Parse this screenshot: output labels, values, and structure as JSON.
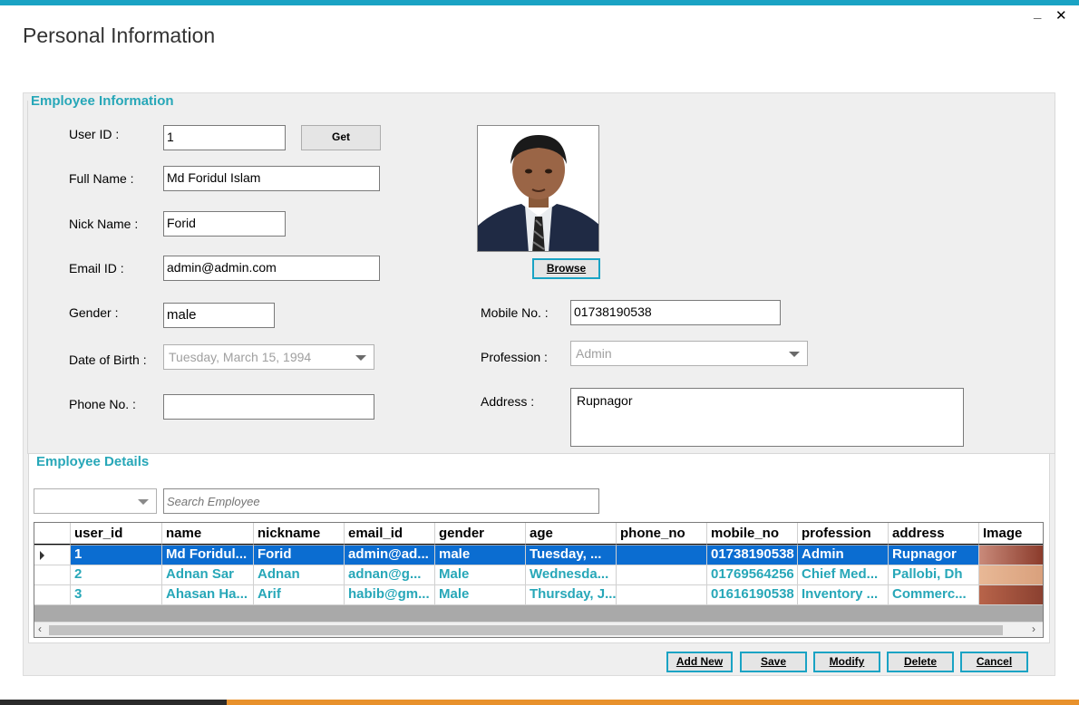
{
  "window": {
    "title": "Personal Information",
    "minimize": "_",
    "close": "✕"
  },
  "employee_info": {
    "group_title": "Employee Information",
    "labels": {
      "user_id": "User ID :",
      "full_name": "Full Name :",
      "nick_name": "Nick Name :",
      "email_id": "Email ID :",
      "gender": "Gender :",
      "dob": "Date of Birth :",
      "phone": "Phone No. :",
      "mobile": "Mobile No. :",
      "profession": "Profession :",
      "address": "Address :"
    },
    "values": {
      "user_id": "1",
      "full_name": "Md Foridul Islam",
      "nick_name": "Forid",
      "email_id": "admin@admin.com",
      "gender": "male",
      "dob": "Tuesday, March 15, 1994",
      "phone": "",
      "mobile": "01738190538",
      "profession": "Admin",
      "address": "Rupnagor"
    },
    "get_button": "Get",
    "browse_button": "Browse"
  },
  "employee_details": {
    "group_title": "Employee Details",
    "filter_value": "",
    "search_placeholder": "Search Employee",
    "columns": [
      "user_id",
      "name",
      "nickname",
      "email_id",
      "gender",
      "age",
      "phone_no",
      "mobile_no",
      "profession",
      "address",
      "Image"
    ],
    "rows": [
      [
        "1",
        "Md Foridul...",
        "Forid",
        "admin@ad...",
        "male",
        "Tuesday, ...",
        "",
        "01738190538",
        "Admin",
        "Rupnagor",
        ""
      ],
      [
        "2",
        "Adnan Sar",
        "Adnan",
        "adnan@g...",
        "Male",
        "Wednesda...",
        "",
        "01769564256",
        "Chief Med...",
        "Pallobi, Dh",
        ""
      ],
      [
        "3",
        "Ahasan Ha...",
        "Arif",
        "habib@gm...",
        "Male",
        "Thursday, J...",
        "",
        "01616190538",
        "Inventory ...",
        "Commerc...",
        ""
      ]
    ],
    "selected_row": 0,
    "scroll_left": "‹",
    "scroll_right": "›"
  },
  "actions": {
    "add_new": "Add New",
    "save": "Save",
    "modify": "Modify",
    "delete": "Delete",
    "cancel": "Cancel"
  },
  "colors": {
    "accent": "#1aa3c4",
    "group_title": "#27a7b8",
    "selection": "#0b6dd1"
  }
}
